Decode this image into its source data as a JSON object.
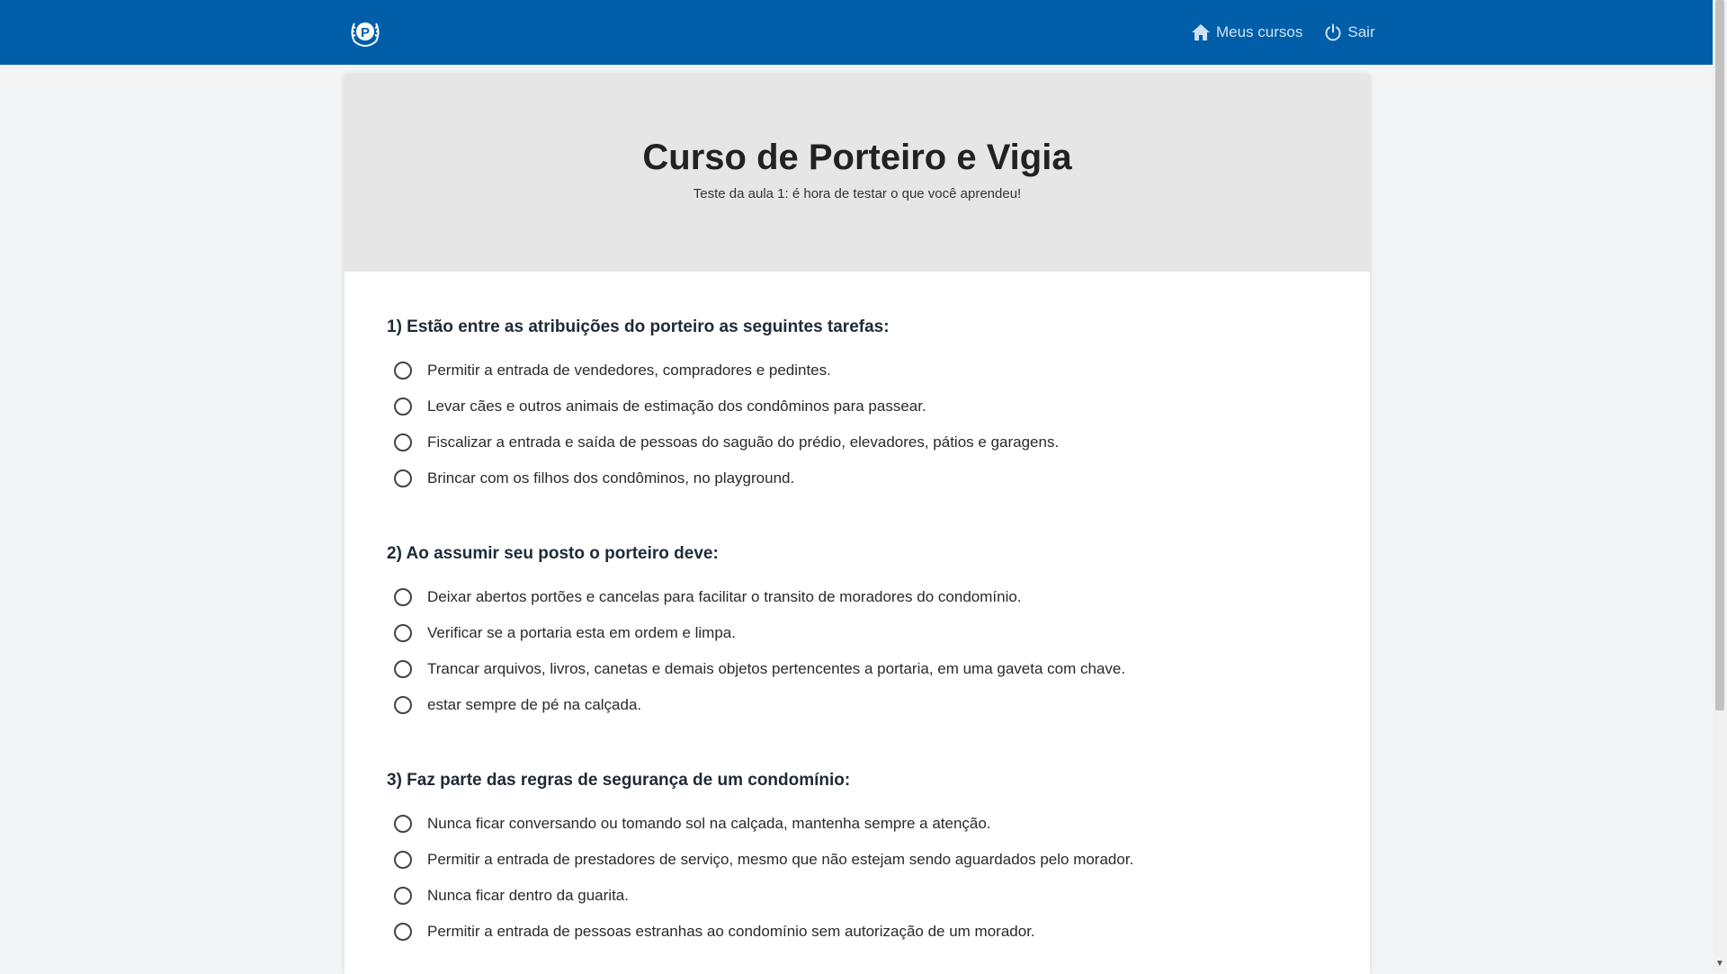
{
  "colors": {
    "topbar": "#005ea8",
    "header_bg": "#e6e6e6",
    "page_bg": "#f3f4f6"
  },
  "nav": {
    "logo_icon": "laurel-p-logo-icon",
    "home_icon": "home-icon",
    "home_label": "Meus cursos",
    "logout_icon": "power-icon",
    "logout_label": "Sair"
  },
  "course": {
    "title": "Curso de Porteiro e Vigia",
    "subtitle": "Teste da aula 1: é hora de testar o que você aprendeu!"
  },
  "questions": [
    {
      "title": "1) Estão entre as atribuições do porteiro as seguintes tarefas:",
      "options": [
        "Permitir a entrada de vendedores, compradores e pedintes.",
        "Levar cães e outros animais de estimação dos condôminos para passear.",
        "Fiscalizar a entrada e saída de pessoas do saguão do prédio, elevadores, pátios e garagens.",
        "Brincar com os filhos dos condôminos, no playground."
      ]
    },
    {
      "title": "2) Ao assumir seu posto o porteiro deve:",
      "options": [
        "Deixar abertos portões e cancelas para facilitar o transito de moradores do condomínio.",
        "Verificar se a portaria esta em ordem e limpa.",
        "Trancar arquivos, livros, canetas e demais objetos pertencentes a portaria, em uma gaveta com chave.",
        "estar sempre de pé na calçada."
      ]
    },
    {
      "title": "3) Faz parte das regras de segurança de um condomínio:",
      "options": [
        "Nunca ficar conversando ou tomando sol na calçada, mantenha sempre a atenção.",
        "Permitir a entrada de prestadores de serviço, mesmo que não estejam sendo aguardados pelo morador.",
        "Nunca ficar dentro da guarita.",
        "Permitir a entrada de pessoas estranhas ao condomínio sem autorização de um morador."
      ]
    }
  ]
}
